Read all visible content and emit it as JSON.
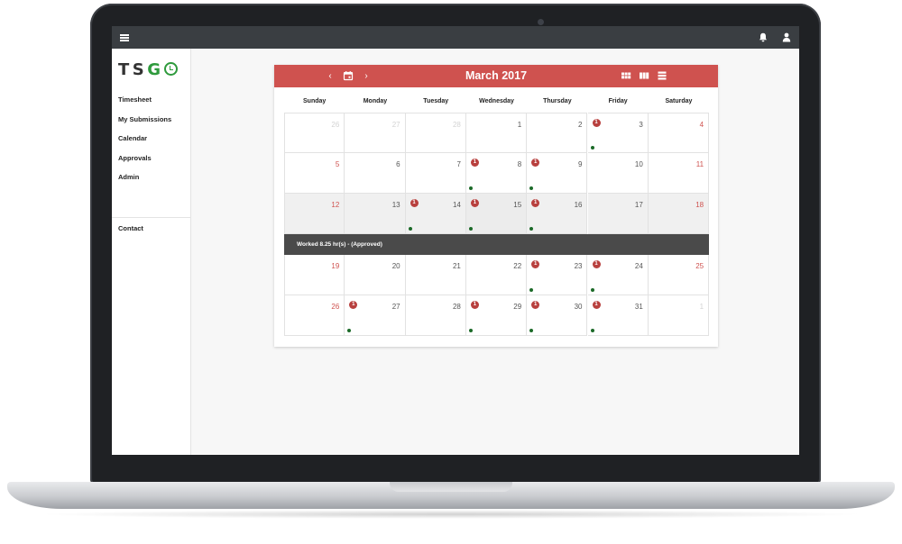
{
  "app": {
    "logo": {
      "letters": "TSG",
      "accent_color": "#2e9a3c"
    },
    "topbar": {
      "icons": [
        "menu-icon",
        "bell-icon",
        "user-icon"
      ]
    },
    "nav": {
      "items": [
        {
          "label": "Timesheet"
        },
        {
          "label": "My Submissions"
        },
        {
          "label": "Calendar"
        },
        {
          "label": "Approvals"
        },
        {
          "label": "Admin"
        }
      ],
      "contact": "Contact"
    }
  },
  "calendar": {
    "title": "March 2017",
    "header_color": "#cf524f",
    "buttons": {
      "prev": "‹",
      "next": "›"
    },
    "weekdays": [
      "Sunday",
      "Monday",
      "Tuesday",
      "Wednesday",
      "Thursday",
      "Friday",
      "Saturday"
    ],
    "weeks": [
      [
        {
          "n": "26",
          "other": true
        },
        {
          "n": "27",
          "other": true
        },
        {
          "n": "28",
          "other": true
        },
        {
          "n": "1"
        },
        {
          "n": "2"
        },
        {
          "n": "3",
          "badge": "1",
          "dot": true
        },
        {
          "n": "4"
        }
      ],
      [
        {
          "n": "5"
        },
        {
          "n": "6"
        },
        {
          "n": "7"
        },
        {
          "n": "8",
          "badge": "1",
          "dot": true
        },
        {
          "n": "9",
          "badge": "1",
          "dot": true
        },
        {
          "n": "10"
        },
        {
          "n": "11"
        }
      ],
      [
        {
          "n": "12"
        },
        {
          "n": "13"
        },
        {
          "n": "14",
          "badge": "1",
          "dot": true
        },
        {
          "n": "15",
          "badge": "1",
          "dot": true
        },
        {
          "n": "16",
          "badge": "1",
          "dot": true
        },
        {
          "n": "17"
        },
        {
          "n": "18"
        }
      ],
      [
        {
          "n": "19"
        },
        {
          "n": "20"
        },
        {
          "n": "21"
        },
        {
          "n": "22"
        },
        {
          "n": "23",
          "badge": "1",
          "dot": true
        },
        {
          "n": "24",
          "badge": "1",
          "dot": true
        },
        {
          "n": "25"
        }
      ],
      [
        {
          "n": "26"
        },
        {
          "n": "27",
          "badge": "1",
          "dot": true
        },
        {
          "n": "28"
        },
        {
          "n": "29",
          "badge": "1",
          "dot": true
        },
        {
          "n": "30",
          "badge": "1",
          "dot": true
        },
        {
          "n": "31",
          "badge": "1",
          "dot": true
        },
        {
          "n": "1",
          "other": true
        }
      ]
    ],
    "selected_day": "15",
    "detail": "Worked 8.25 hr(s) - (Approved)"
  }
}
